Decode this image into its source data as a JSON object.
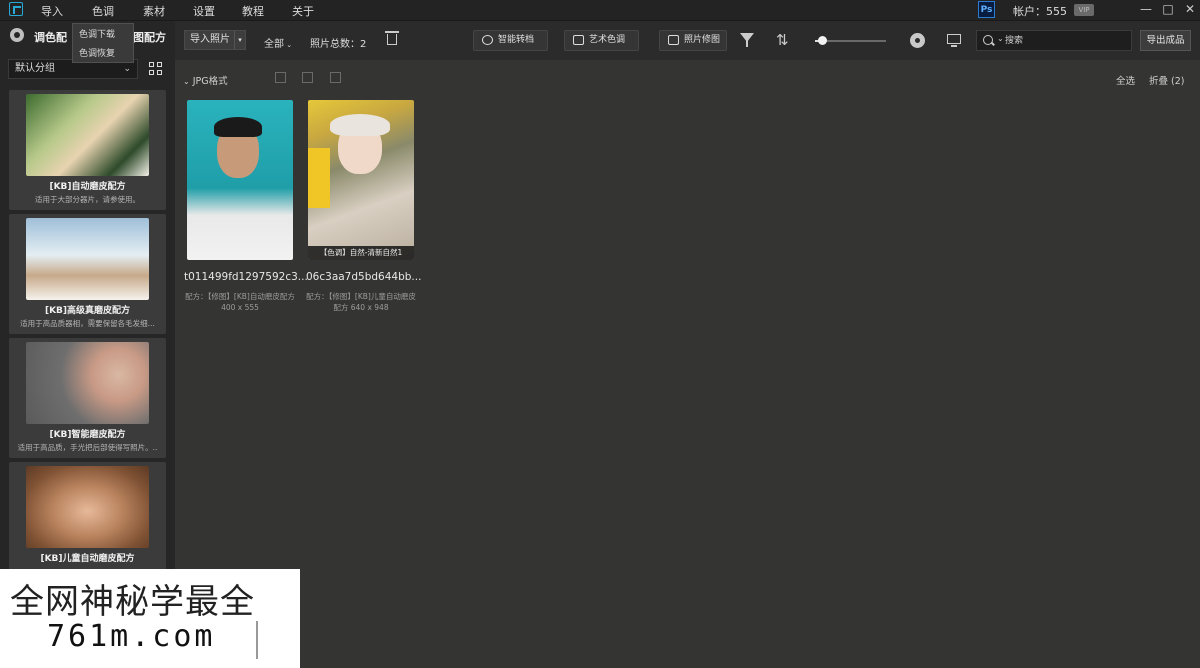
{
  "menu": {
    "items": [
      "导入",
      "色调",
      "素材",
      "设置",
      "教程",
      "关于"
    ]
  },
  "window": {
    "ps_label": "Ps",
    "account": "帐户：555",
    "vip": "VIP",
    "minimize": "—",
    "maximize": "□",
    "close": "✕"
  },
  "sidebar": {
    "tab_label": "调色配",
    "tab_label_right": "图配方",
    "dropdown": [
      "色调下载",
      "色调恢复"
    ],
    "group_select": "默认分组",
    "presets": [
      {
        "name": "[KB]自动磨皮配方",
        "desc": "适用于大部分器片，请参使用。"
      },
      {
        "name": "[KB]高级真磨皮配方",
        "desc": "适用于高品质器相，需要保留各毛发细..."
      },
      {
        "name": "[KB]智能磨皮配方",
        "desc": "适用于高品质，手光把后部使得写照片。.."
      },
      {
        "name": "[KB]儿童自动磨皮配方",
        "desc": ""
      }
    ]
  },
  "toolbar": {
    "import_label": "导入照片",
    "filter_all": "全部",
    "photo_count": "照片总数：2",
    "buttons": [
      "智能转档",
      "艺术色调",
      "照片修图"
    ],
    "zoom_level": 0.1,
    "search_placeholder": "搜索",
    "export_label": "导出成品"
  },
  "main": {
    "group_name": "JPG格式",
    "select_all": "全选",
    "collapse": "折叠 (2)",
    "photos": [
      {
        "filename": "t011499fd1297592c3...",
        "meta": "配方：【修图】[KB]自动磨皮配方    400 x 555",
        "label": ""
      },
      {
        "filename": "06c3aa7d5bd644bb...",
        "meta": "配方：【修图】[KB]儿童自动磨皮配方    640 x 948",
        "label": "【色调】自然-清新自然1"
      }
    ]
  },
  "watermark": {
    "line1": "全网神秘学最全",
    "line2": "761m.com"
  }
}
